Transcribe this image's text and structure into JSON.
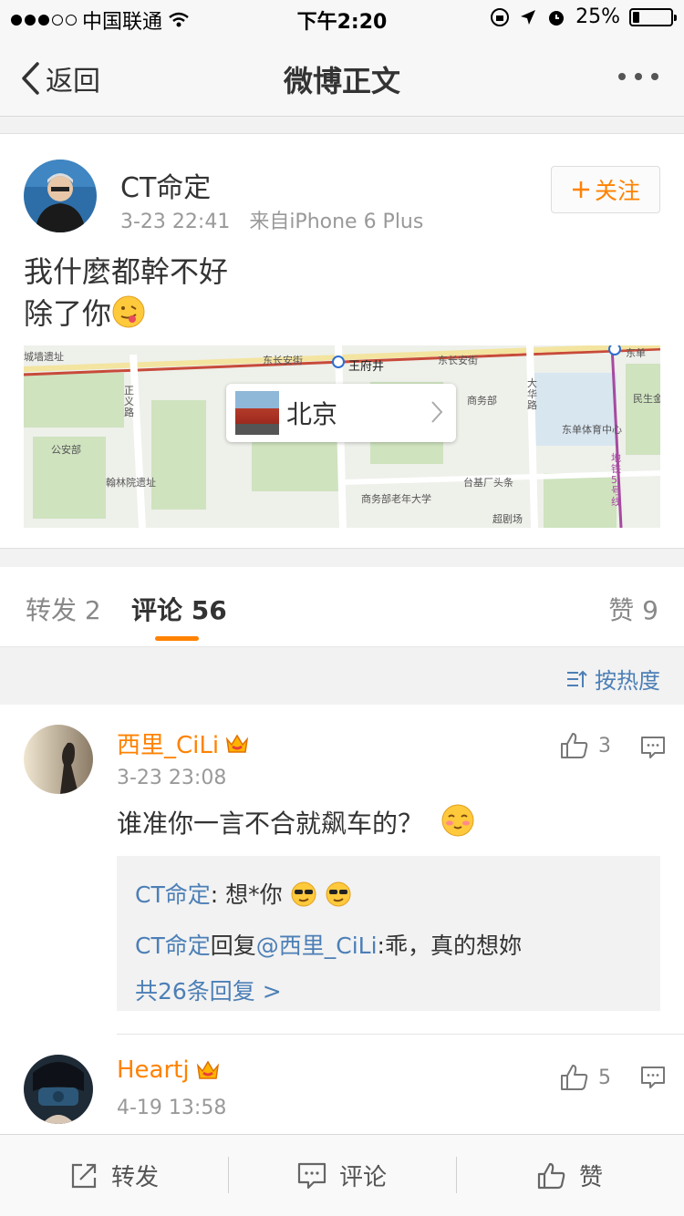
{
  "status_bar": {
    "carrier": "中国联通",
    "time": "下午2:20",
    "battery": "25%",
    "battery_level": 0.25
  },
  "nav": {
    "back_label": "返回",
    "title": "微博正文"
  },
  "post": {
    "author": "CT命定",
    "time": "3-23 22:41",
    "source": "来自iPhone 6 Plus",
    "follow_label": "关注",
    "text_line1": "我什麼都幹不好",
    "text_line2": "除了你",
    "map_location": "北京",
    "map_labels": [
      "东长安街",
      "王府井",
      "东长安街",
      "商务部",
      "正义路",
      "公安部",
      "东单体育中心",
      "民生金",
      "翰林院遗址",
      "台基厂头条",
      "商务部老年大学",
      "超剧场",
      "城墙遗址",
      "大华路",
      "东单",
      "地铁5号线"
    ]
  },
  "tabs": {
    "repost_label": "转发",
    "repost_count": "2",
    "comment_label": "评论",
    "comment_count": "56",
    "like_label": "赞",
    "like_count": "9"
  },
  "sort_label": "按热度",
  "comments": [
    {
      "name": "西里_CiLi",
      "time": "3-23 23:08",
      "likes": "3",
      "text": "谁准你一言不合就飙车的？",
      "replies": {
        "r1_user": "CT命定",
        "r1_text": ": 想*你",
        "r2_user": "CT命定",
        "r2_mid": "回复",
        "r2_mention": "@西里_CiLi",
        "r2_text": ":乖，真的想妳",
        "all_label": "共26条回复 >"
      }
    },
    {
      "name": "Heartj",
      "time": "4-19 13:58",
      "likes": "5"
    }
  ],
  "toolbar": {
    "repost": "转发",
    "comment": "评论",
    "like": "赞"
  },
  "colors": {
    "accent": "#ff8200",
    "link": "#4c7fb6"
  }
}
